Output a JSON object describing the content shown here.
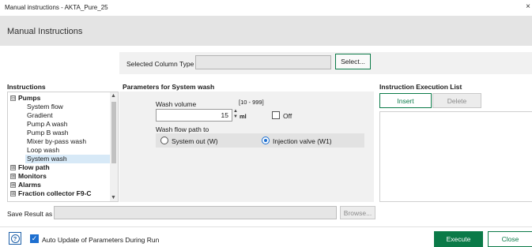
{
  "window": {
    "title": "Manual instructions - AKTA_Pure_25",
    "close_glyph": "×"
  },
  "header": {
    "heading": "Manual Instructions"
  },
  "column_type": {
    "label": "Selected Column Type",
    "value": "",
    "select_button": "Select..."
  },
  "instructions": {
    "title": "Instructions",
    "tree": [
      {
        "label": "Pumps",
        "group": true,
        "expander": "⊟"
      },
      {
        "label": "System flow",
        "group": false
      },
      {
        "label": "Gradient",
        "group": false
      },
      {
        "label": "Pump A wash",
        "group": false
      },
      {
        "label": "Pump B wash",
        "group": false
      },
      {
        "label": "Mixer by-pass wash",
        "group": false
      },
      {
        "label": "Loop wash",
        "group": false
      },
      {
        "label": "System wash",
        "group": false,
        "selected": true
      },
      {
        "label": "Flow path",
        "group": true,
        "expander": "⊞"
      },
      {
        "label": "Monitors",
        "group": true,
        "expander": "⊞"
      },
      {
        "label": "Alarms",
        "group": true,
        "expander": "⊞"
      },
      {
        "label": "Fraction collector F9-C",
        "group": true,
        "expander": "⊞"
      }
    ]
  },
  "parameters": {
    "title": "Parameters for System wash",
    "wash_volume_label": "Wash volume",
    "range": "[10 - 999]",
    "wash_volume_value": "15",
    "unit": "ml",
    "off_label": "Off",
    "off_checked": false,
    "flow_path_label": "Wash flow path to",
    "options": [
      {
        "label": "System out (W)",
        "checked": false
      },
      {
        "label": "Injection valve (W1)",
        "checked": true
      }
    ]
  },
  "execution_list": {
    "title": "Instruction Execution List",
    "insert_button": "Insert",
    "delete_button": "Delete",
    "items": []
  },
  "save_result": {
    "label": "Save Result as",
    "value": "",
    "browse_button": "Browse..."
  },
  "footer": {
    "help_glyph": "?",
    "auto_update_label": "Auto Update of Parameters During Run",
    "auto_update_checked": true,
    "execute_button": "Execute",
    "close_button": "Close"
  },
  "colors": {
    "accent_green": "#0b7a48",
    "accent_blue": "#1d6fd0",
    "header_bg": "#e4e4e4",
    "panel_bg": "#f1f1f1"
  }
}
